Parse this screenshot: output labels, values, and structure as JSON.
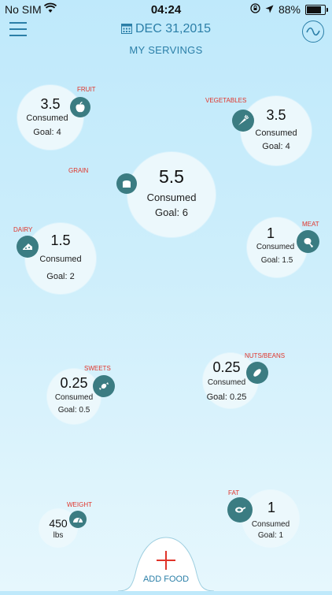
{
  "status": {
    "carrier": "No SIM",
    "time": "04:24",
    "battery": "88%",
    "battery_level": 0.88
  },
  "header": {
    "date": "DEC 31,2015",
    "subtitle": "MY SERVINGS"
  },
  "foods": {
    "fruit": {
      "category": "FRUIT",
      "value": "3.5",
      "label": "Consumed",
      "goal": "Goal: 4",
      "icon": "apple-icon"
    },
    "vegetables": {
      "category": "VEGETABLES",
      "value": "3.5",
      "label": "Consumed",
      "goal": "Goal: 4",
      "icon": "carrot-icon"
    },
    "grain": {
      "category": "GRAIN",
      "value": "5.5",
      "label": "Consumed",
      "goal": "Goal: 6",
      "icon": "bread-icon"
    },
    "dairy": {
      "category": "DAIRY",
      "value": "1.5",
      "label": "Consumed",
      "goal": "Goal: 2",
      "icon": "cheese-icon"
    },
    "meat": {
      "category": "MEAT",
      "value": "1",
      "label": "Consumed",
      "goal": "Goal: 1.5",
      "icon": "drumstick-icon"
    },
    "sweets": {
      "category": "SWEETS",
      "value": "0.25",
      "label": "Consumed",
      "goal": "Goal: 0.5",
      "icon": "candy-icon"
    },
    "nuts": {
      "category": "NUTS/BEANS",
      "value": "0.25",
      "label": "Consumed",
      "goal": "Goal: 0.25",
      "icon": "bean-icon"
    },
    "fat": {
      "category": "FAT",
      "value": "1",
      "label": "Consumed",
      "goal": "Goal: 1",
      "icon": "pan-icon"
    },
    "weight": {
      "category": "WEIGHT",
      "value": "450",
      "unit": "lbs",
      "icon": "scale-icon"
    }
  },
  "add_food": {
    "label": "ADD FOOD"
  },
  "colors": {
    "accent": "#2b7fa8",
    "category": "#e0342a",
    "icon_bg": "#3b7c82",
    "add_plus": "#e0342a"
  }
}
